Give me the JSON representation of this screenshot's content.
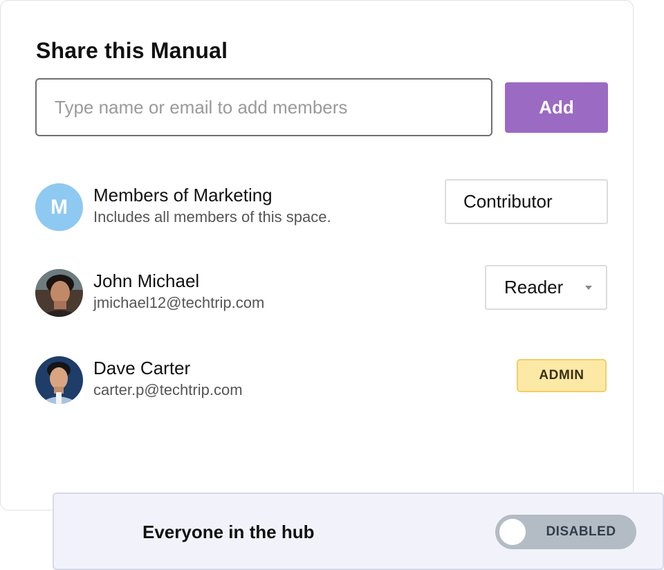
{
  "share": {
    "title": "Share this Manual",
    "input_placeholder": "Type name or email to add members",
    "input_value": "",
    "add_label": "Add"
  },
  "members": [
    {
      "name": "Members of Marketing",
      "sub": "Includes all members of this space.",
      "avatar_letter": "M",
      "avatar_color": "#8ec9f2",
      "role": "Contributor"
    },
    {
      "name": "John Michael",
      "sub": "jmichael12@techtrip.com",
      "role": "Reader"
    },
    {
      "name": "Dave Carter",
      "sub": "carter.p@techtrip.com",
      "role": "ADMIN"
    }
  ],
  "hub": {
    "label": "Everyone in the hub",
    "toggle_state": "DISABLED"
  },
  "colors": {
    "accent": "#9b6ac3",
    "admin_badge": "#fde9a6",
    "toggle_off": "#b3bcc5"
  },
  "icons": [
    "chevron-down-icon"
  ]
}
